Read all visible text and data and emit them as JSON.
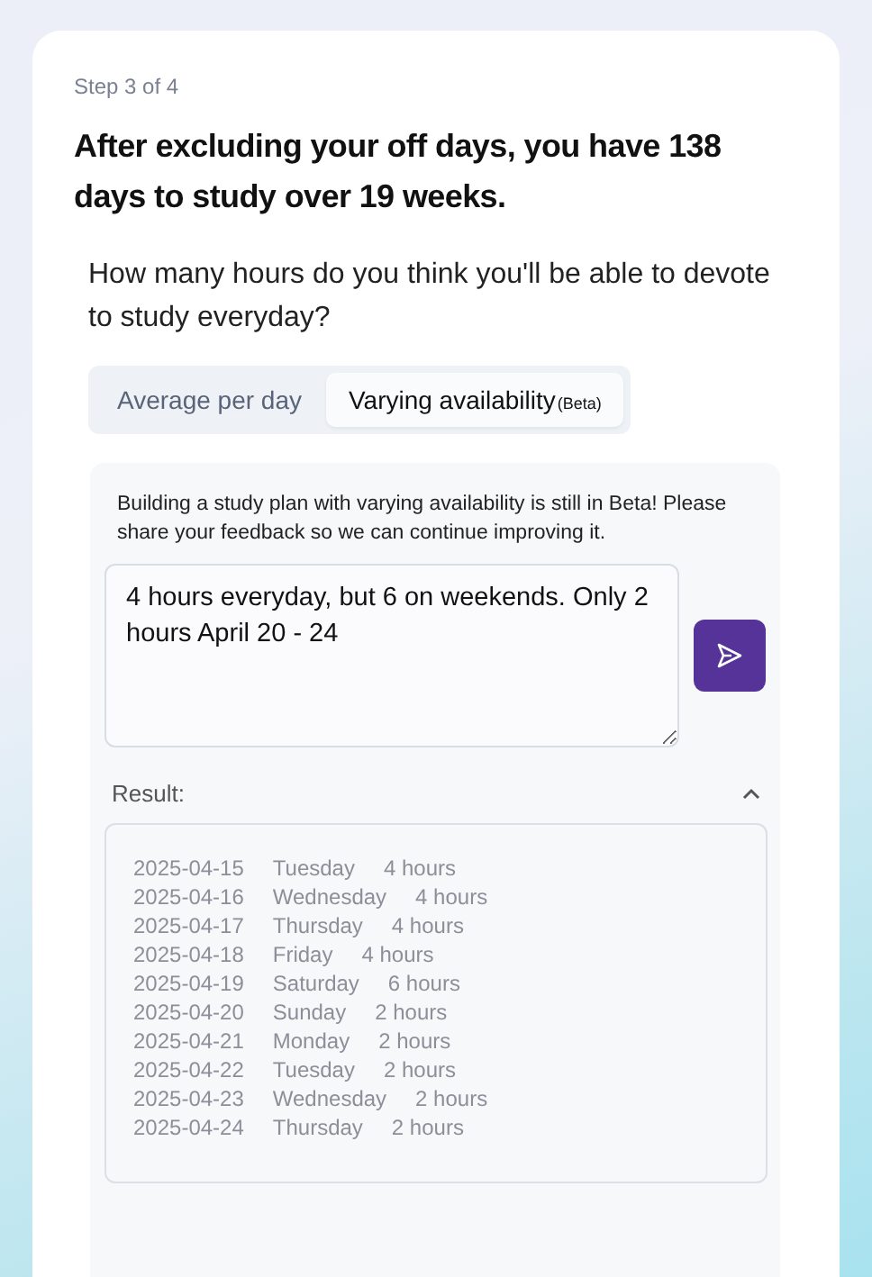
{
  "step": "Step 3 of 4",
  "heading": "After excluding your off days, you have 138 days to study over 19 weeks.",
  "question": "How many hours do you think you'll be able to devote to study everyday?",
  "tabs": [
    {
      "label": "Average per day",
      "selected": false
    },
    {
      "label": "Varying availability",
      "badge": "(Beta)",
      "selected": true
    }
  ],
  "beta_notice": "Building a study plan with varying availability is still in Beta! Please share your feedback so we can continue improving it.",
  "input": {
    "value": "4 hours everyday, but 6 on weekends. Only 2 hours April 20 - 24"
  },
  "result": {
    "label": "Result:",
    "expanded": true,
    "rows": [
      {
        "date": "2025-04-15",
        "day": "Tuesday",
        "hours": "4 hours"
      },
      {
        "date": "2025-04-16",
        "day": "Wednesday",
        "hours": "4 hours"
      },
      {
        "date": "2025-04-17",
        "day": "Thursday",
        "hours": "4 hours"
      },
      {
        "date": "2025-04-18",
        "day": "Friday",
        "hours": "4 hours"
      },
      {
        "date": "2025-04-19",
        "day": "Saturday",
        "hours": "6 hours"
      },
      {
        "date": "2025-04-20",
        "day": "Sunday",
        "hours": "2 hours"
      },
      {
        "date": "2025-04-21",
        "day": "Monday",
        "hours": "2 hours"
      },
      {
        "date": "2025-04-22",
        "day": "Tuesday",
        "hours": "2 hours"
      },
      {
        "date": "2025-04-23",
        "day": "Wednesday",
        "hours": "2 hours"
      },
      {
        "date": "2025-04-24",
        "day": "Thursday",
        "hours": "2 hours"
      }
    ]
  }
}
